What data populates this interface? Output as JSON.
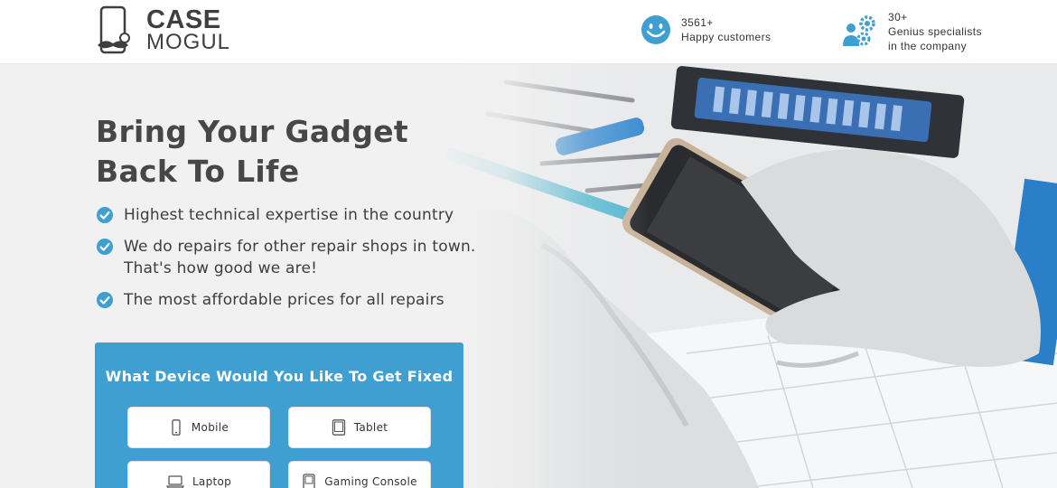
{
  "brand": {
    "line1": "CASE",
    "line2": "MOGUL"
  },
  "stats": [
    {
      "icon": "smiley-icon",
      "value": "3561+",
      "label": "Happy customers"
    },
    {
      "icon": "specialists-gears-icon",
      "value": "30+",
      "label_line1": "Genius specialists",
      "label_line2": "in the company"
    }
  ],
  "hero": {
    "headline_line1": "Bring Your Gadget",
    "headline_line2": "Back To Life",
    "bullets": [
      {
        "line1": "Highest technical expertise in the country"
      },
      {
        "line1": "We do repairs for other repair shops in town.",
        "line2": "That's how good we are!"
      },
      {
        "line1": "The most affordable prices for all repairs"
      }
    ]
  },
  "device_panel": {
    "title": "What Device Would You Like To Get Fixed",
    "devices": [
      {
        "icon": "mobile-icon",
        "label": "Mobile"
      },
      {
        "icon": "tablet-icon",
        "label": "Tablet"
      },
      {
        "icon": "laptop-icon",
        "label": "Laptop"
      },
      {
        "icon": "gaming-console-icon",
        "label": "Gaming Console"
      }
    ]
  },
  "colors": {
    "accent": "#3f9fd0",
    "text": "#474747",
    "background": "#f1f1f1"
  }
}
